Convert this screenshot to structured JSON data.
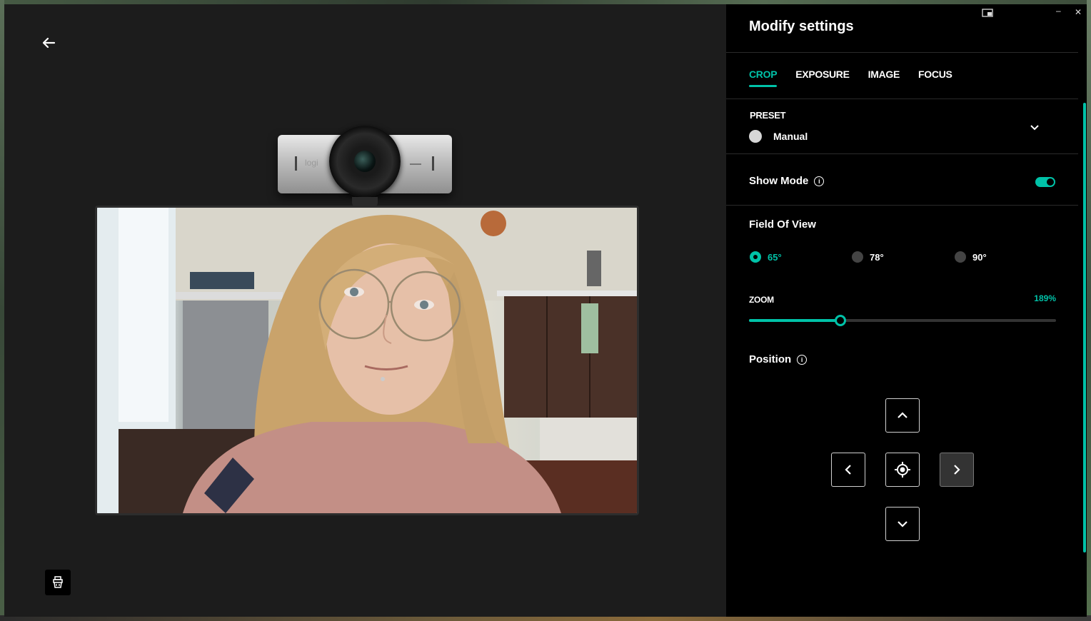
{
  "panel": {
    "title": "Modify settings",
    "tabs": [
      {
        "label": "CROP",
        "active": true
      },
      {
        "label": "EXPOSURE",
        "active": false
      },
      {
        "label": "IMAGE",
        "active": false
      },
      {
        "label": "FOCUS",
        "active": false
      }
    ],
    "preset": {
      "heading": "PRESET",
      "value": "Manual"
    },
    "show_mode": {
      "label": "Show Mode",
      "enabled": true
    },
    "field_of_view": {
      "label": "Field Of View",
      "options": [
        {
          "label": "65°",
          "selected": true
        },
        {
          "label": "78°",
          "selected": false
        },
        {
          "label": "90°",
          "selected": false
        }
      ]
    },
    "zoom": {
      "label": "ZOOM",
      "value_text": "189%",
      "fraction": 0.298
    },
    "position": {
      "label": "Position"
    }
  },
  "preview": {
    "camera_brand": "logi"
  },
  "colors": {
    "accent": "#00c2a8",
    "panel_bg": "#000000",
    "preview_bg": "#1c1c1c"
  },
  "icons": [
    "back-arrow-icon",
    "lens-clean-icon",
    "chevron-down-icon",
    "info-icon",
    "chevron-up-icon",
    "chevron-left-icon",
    "chevron-right-icon",
    "recenter-icon",
    "minimize-icon",
    "close-icon",
    "pip-icon"
  ]
}
